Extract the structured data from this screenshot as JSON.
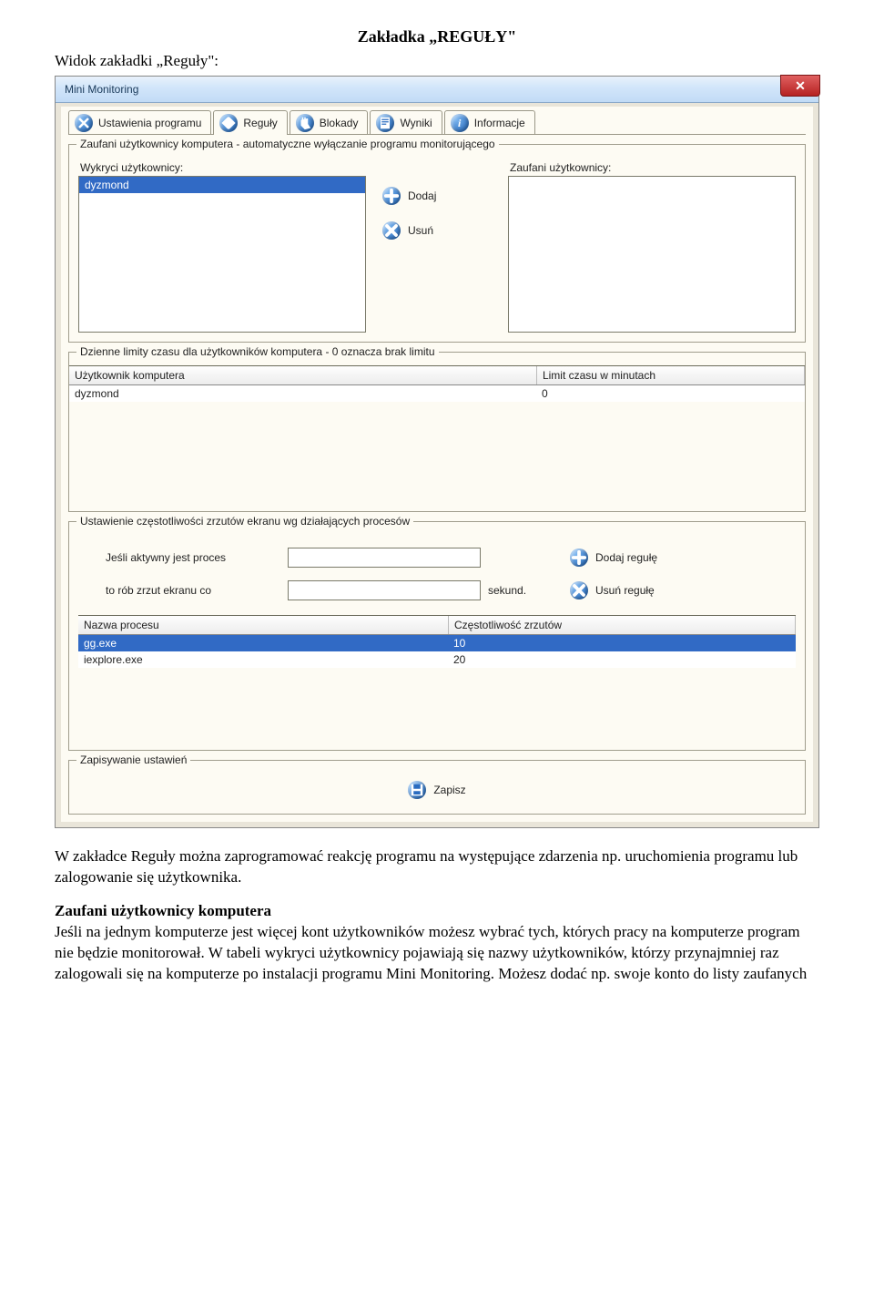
{
  "doc": {
    "title": "Zakładka „REGUŁY\"",
    "intro": "Widok zakładki „Reguły\":",
    "para1": "W zakładce Reguły można zaprogramować reakcję programu na występujące zdarzenia np. uruchomienia programu lub zalogowanie się użytkownika.",
    "para2_heading": "Zaufani użytkownicy komputera",
    "para2_body": "Jeśli na jednym komputerze jest więcej kont użytkowników możesz wybrać tych, których pracy na komputerze program nie będzie monitorował. W tabeli wykryci użytkownicy pojawiają się nazwy użytkowników, którzy przynajmniej raz zalogowali się na komputerze po instalacji programu Mini Monitoring. Możesz dodać np. swoje konto do listy zaufanych"
  },
  "window": {
    "title": "Mini Monitoring"
  },
  "tabs": {
    "settings": "Ustawienia programu",
    "rules": "Reguły",
    "blocks": "Blokady",
    "results": "Wyniki",
    "info": "Informacje"
  },
  "trusted": {
    "group_title": "Zaufani użytkownicy komputera - automatyczne wyłączanie programu monitorującego",
    "detected_label": "Wykryci użytkownicy:",
    "trusted_label": "Zaufani użytkownicy:",
    "detected_items": [
      "dyzmond"
    ],
    "add_label": "Dodaj",
    "remove_label": "Usuń"
  },
  "limits": {
    "group_title": "Dzienne limity czasu dla użytkowników komputera - 0 oznacza brak limitu",
    "col_user": "Użytkownik komputera",
    "col_limit": "Limit czasu w minutach",
    "rows": [
      {
        "user": "dyzmond",
        "limit": "0"
      }
    ]
  },
  "freq": {
    "group_title": "Ustawienie częstotliwości zrzutów ekranu wg działających procesów",
    "label_if": "Jeśli aktywny jest proces",
    "label_then": "to rób zrzut ekranu co",
    "seconds": "sekund.",
    "add_rule": "Dodaj regułę",
    "remove_rule": "Usuń regułę",
    "col_process": "Nazwa procesu",
    "col_freq": "Częstotliwość zrzutów",
    "rows": [
      {
        "process": "gg.exe",
        "freq": "10",
        "selected": true
      },
      {
        "process": "iexplore.exe",
        "freq": "20",
        "selected": false
      }
    ]
  },
  "save": {
    "group_title": "Zapisywanie ustawień",
    "label": "Zapisz"
  }
}
